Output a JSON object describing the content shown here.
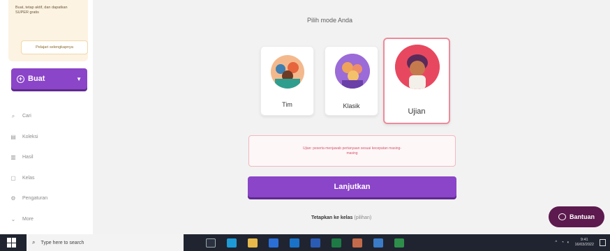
{
  "sidebar": {
    "promo_text": "Buat, tetap aktif, dan dapatkan SUPER gratis",
    "promo_button": "Pelajari selengkapnya",
    "create_label": "Buat",
    "nav": [
      {
        "label": "Cari",
        "icon": "search-icon"
      },
      {
        "label": "Koleksi",
        "icon": "library-icon"
      },
      {
        "label": "Hasil",
        "icon": "reports-icon"
      },
      {
        "label": "Kelas",
        "icon": "class-icon"
      },
      {
        "label": "Pengaturan",
        "icon": "settings-icon"
      },
      {
        "label": "More",
        "icon": "more-icon"
      }
    ]
  },
  "main": {
    "title": "Pilih mode Anda",
    "modes": [
      {
        "label": "Tim",
        "selected": false
      },
      {
        "label": "Klasik",
        "selected": false
      },
      {
        "label": "Ujian",
        "selected": true
      }
    ],
    "alert_text": "Ujian: peserta menjawab pertanyaan sesuai kecepatan masing-masing",
    "continue_label": "Lanjutkan",
    "assign_label": "Tetapkan ke kelas",
    "assign_optional": "(pilihan)"
  },
  "help": {
    "label": "Bantuan"
  },
  "taskbar": {
    "search_placeholder": "Type here to search",
    "time": "9:41",
    "date": "16/03/2022"
  },
  "colors": {
    "accent": "#8b45c8",
    "alert": "#d6566b",
    "help": "#5c1a4e"
  }
}
